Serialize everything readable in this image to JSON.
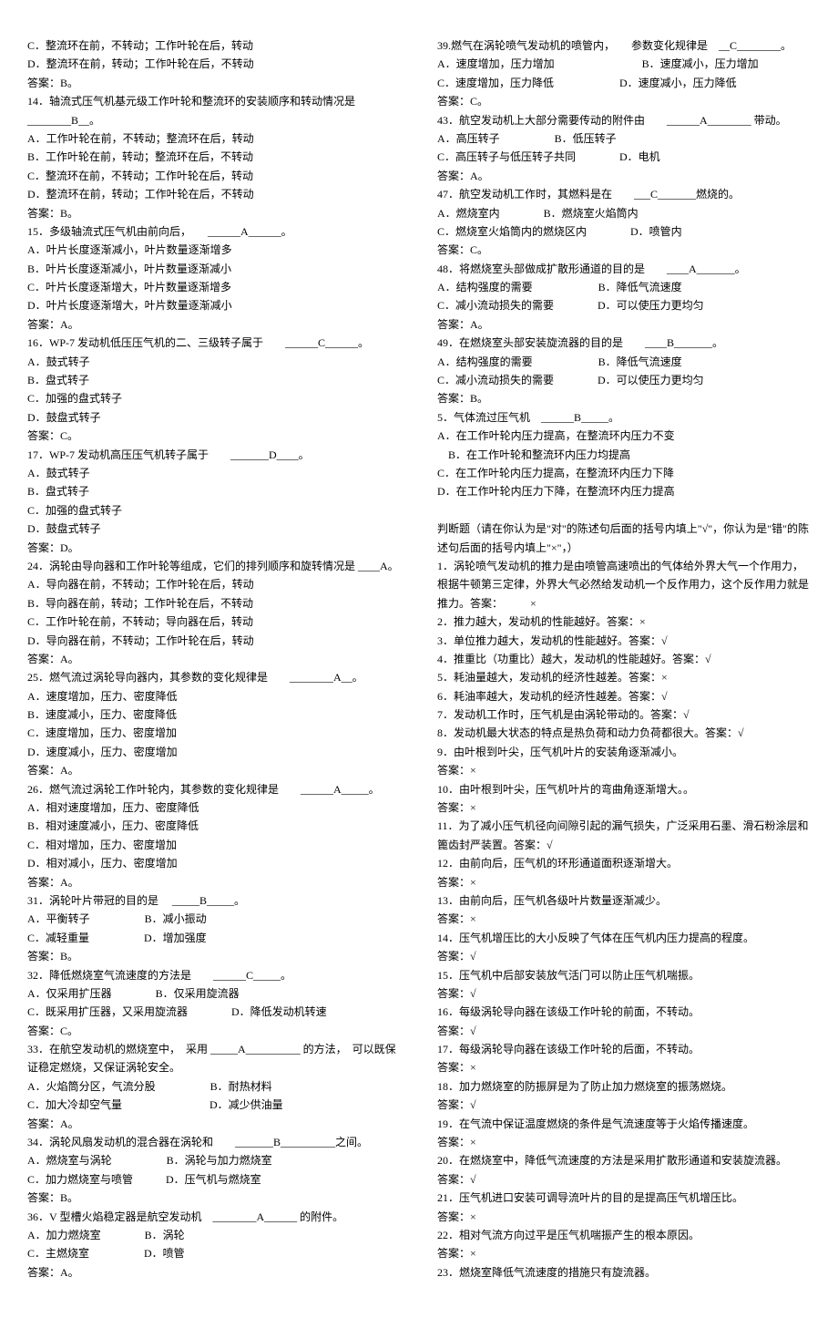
{
  "left": [
    "C．整流环在前，不转动；工作叶轮在后，转动",
    "D．整流环在前，转动；工作叶轮在后，不转动",
    "答案：B。",
    "14．轴流式压气机基元级工作叶轮和整流环的安装顺序和转动情况是 ________B__。",
    "A．工作叶轮在前，不转动；整流环在后，转动",
    "B．工作叶轮在前，转动；整流环在后，不转动",
    "C．整流环在前，不转动；工作叶轮在后，转动",
    "D．整流环在前，转动；工作叶轮在后，不转动",
    "答案：B。",
    "15．多级轴流式压气机由前向后，　　______A______。",
    "A．叶片长度逐渐减小，叶片数量逐渐增多",
    "B．叶片长度逐渐减小，叶片数量逐渐减小",
    "C．叶片长度逐渐增大，叶片数量逐渐增多",
    "D．叶片长度逐渐增大，叶片数量逐渐减小",
    "答案：A。",
    "16．WP-7 发动机低压压气机的二、三级转子属于　　______C______。",
    "A．鼓式转子",
    "B．盘式转子",
    "C．加强的盘式转子",
    "D．鼓盘式转子",
    "答案：C。",
    "17．WP-7 发动机高压压气机转子属于　　_______D____。",
    "A．鼓式转子",
    "B．盘式转子",
    "C．加强的盘式转子",
    "D．鼓盘式转子",
    "答案：D。",
    "24．涡轮由导向器和工作叶轮等组成，它们的排列顺序和旋转情况是 ____A。",
    "A．导向器在前，不转动；工作叶轮在后，转动",
    "B．导向器在前，转动；工作叶轮在后，不转动",
    "C．工作叶轮在前，不转动；导向器在后，转动",
    "D．导向器在前，不转动；工作叶轮在后，转动",
    "答案：A。",
    "25．燃气流过涡轮导向器内，其参数的变化规律是　　________A__。",
    "A．速度增加，压力、密度降低",
    "B．速度减小，压力、密度降低",
    "C．速度增加，压力、密度增加",
    "D．速度减小，压力、密度增加",
    "答案：A。",
    "26．燃气流过涡轮工作叶轮内，其参数的变化规律是　　______A_____。",
    "A．相对速度增加，压力、密度降低",
    "B．相对速度减小，压力、密度降低",
    "C．相对增加，压力、密度增加",
    "D．相对减小，压力、密度增加",
    "答案：A。",
    "31．涡轮叶片带冠的目的是 　_____B_____。",
    "A．平衡转子　　　　　B．减小振动",
    "C．减轻重量　　　　　D．增加强度",
    "答案：B。",
    "32．降低燃烧室气流速度的方法是　　______C_____。",
    "A．仅采用扩压器　　　　B．仅采用旋流器",
    "C．既采用扩压器，又采用旋流器　　　　D．降低发动机转速",
    "答案：C。",
    "33．在航空发动机的燃烧室中，　采用 _____A__________ 的方法，　可以既保证稳定燃烧，又保证涡轮安全。",
    "A．火焰筒分区，气流分股　　　　　B．耐热材料",
    "C．加大冷却空气量　　　　　　　　D．减少供油量",
    "答案：A。",
    "34．涡轮风扇发动机的混合器在涡轮和　　_______B__________之间。",
    "A．燃烧室与涡轮　　　　　B．涡轮与加力燃烧室",
    "C．加力燃烧室与喷管　　　D．压气机与燃烧室",
    "答案：B。",
    "36．V 型槽火焰稳定器是航空发动机　________A______ 的附件。",
    "A．加力燃烧室　　　　B．涡轮",
    "C．主燃烧室　　　　　D．喷管",
    "答案：A。"
  ],
  "right": [
    "39.燃气在涡轮喷气发动机的喷管内，　　参数变化规律是　__C________。",
    "A．速度增加，压力增加　　　　　　　　B．速度减小，压力增加",
    "C．速度增加，压力降低　　　　　　D．速度减小，压力降低",
    "答案：C。",
    "43．航空发动机上大部分需要传动的附件由　　______A________ 带动。",
    "A．高压转子　　　　　B．低压转子",
    "C．高压转子与低压转子共同　　　　D．电机",
    "答案：A。",
    "47．航空发动机工作时，其燃料是在　　___C_______燃烧的。",
    "A．燃烧室内　　　　B．燃烧室火焰筒内",
    "C．燃烧室火焰筒内的燃烧区内　　　　D．喷管内",
    "答案：C。",
    "48．将燃烧室头部做成扩散形通道的目的是　　____A_______。",
    "A．结构强度的需要　　　　　　B．降低气流速度",
    "C．减小流动损失的需要　　　　D．可以使压力更均匀",
    "答案：A。",
    "49．在燃烧室头部安装旋流器的目的是　　____B_______。",
    "A．结构强度的需要　　　　　　B．降低气流速度",
    "C．减小流动损失的需要　　　　D．可以使压力更均匀",
    "答案：B。",
    "5．气体流过压气机　______B_____。",
    "A．在工作叶轮内压力提高，在整流环内压力不变",
    "　B．在工作叶轮和整流环内压力均提高",
    "C．在工作叶轮内压力提高，在整流环内压力下降",
    "D．在工作叶轮内压力下降，在整流环内压力提高",
    "",
    "判断题（请在你认为是\"对\"的陈述句后面的括号内填上\"√\"，你认为是\"错\"的陈述句后面的括号内填上\"×\"，）",
    "1．涡轮喷气发动机的推力是由喷管高速喷出的气体给外界大气一个作用力，根据牛顿第三定律，外界大气必然给发动机一个反作用力，这个反作用力就是推力。答案：　　　×",
    "2．推力越大，发动机的性能越好。答案：×",
    "3．单位推力越大，发动机的性能越好。答案：√",
    "4．推重比（功重比）越大，发动机的性能越好。答案：√",
    "5．耗油量越大，发动机的经济性越差。答案：×",
    "6．耗油率越大，发动机的经济性越差。答案：√",
    "7．发动机工作时，压气机是由涡轮带动的。答案：√",
    "8．发动机最大状态的特点是热负荷和动力负荷都很大。答案：√",
    "9．由叶根到叶尖，压气机叶片的安装角逐渐减小。",
    "答案：×",
    "10．由叶根到叶尖，压气机叶片的弯曲角逐渐增大。。",
    "答案：×",
    "11．为了减小压气机径向间隙引起的漏气损失，广泛采用石墨、滑石粉涂层和篦齿封严装置。答案：√",
    "12．由前向后，压气机的环形通道面积逐渐增大。",
    "答案：×",
    "13．由前向后，压气机各级叶片数量逐渐减少。",
    "答案：×",
    "14．压气机增压比的大小反映了气体在压气机内压力提高的程度。",
    "答案：√",
    "15．压气机中后部安装放气活门可以防止压气机喘振。",
    "答案：√",
    "16．每级涡轮导向器在该级工作叶轮的前面，不转动。",
    "答案：√",
    "17．每级涡轮导向器在该级工作叶轮的后面，不转动。",
    "答案：×",
    "18．加力燃烧室的防振屏是为了防止加力燃烧室的振荡燃烧。",
    "答案：√",
    "19．在气流中保证温度燃烧的条件是气流速度等于火焰传播速度。",
    "答案：×",
    "20．在燃烧室中，降低气流速度的方法是采用扩散形通道和安装旋流器。",
    "答案：√",
    "21．压气机进口安装可调导流叶片的目的是提高压气机增压比。",
    "答案：×",
    "22．相对气流方向过平是压气机喘振产生的根本原因。",
    "答案：×",
    "23．燃烧室降低气流速度的措施只有旋流器。"
  ]
}
